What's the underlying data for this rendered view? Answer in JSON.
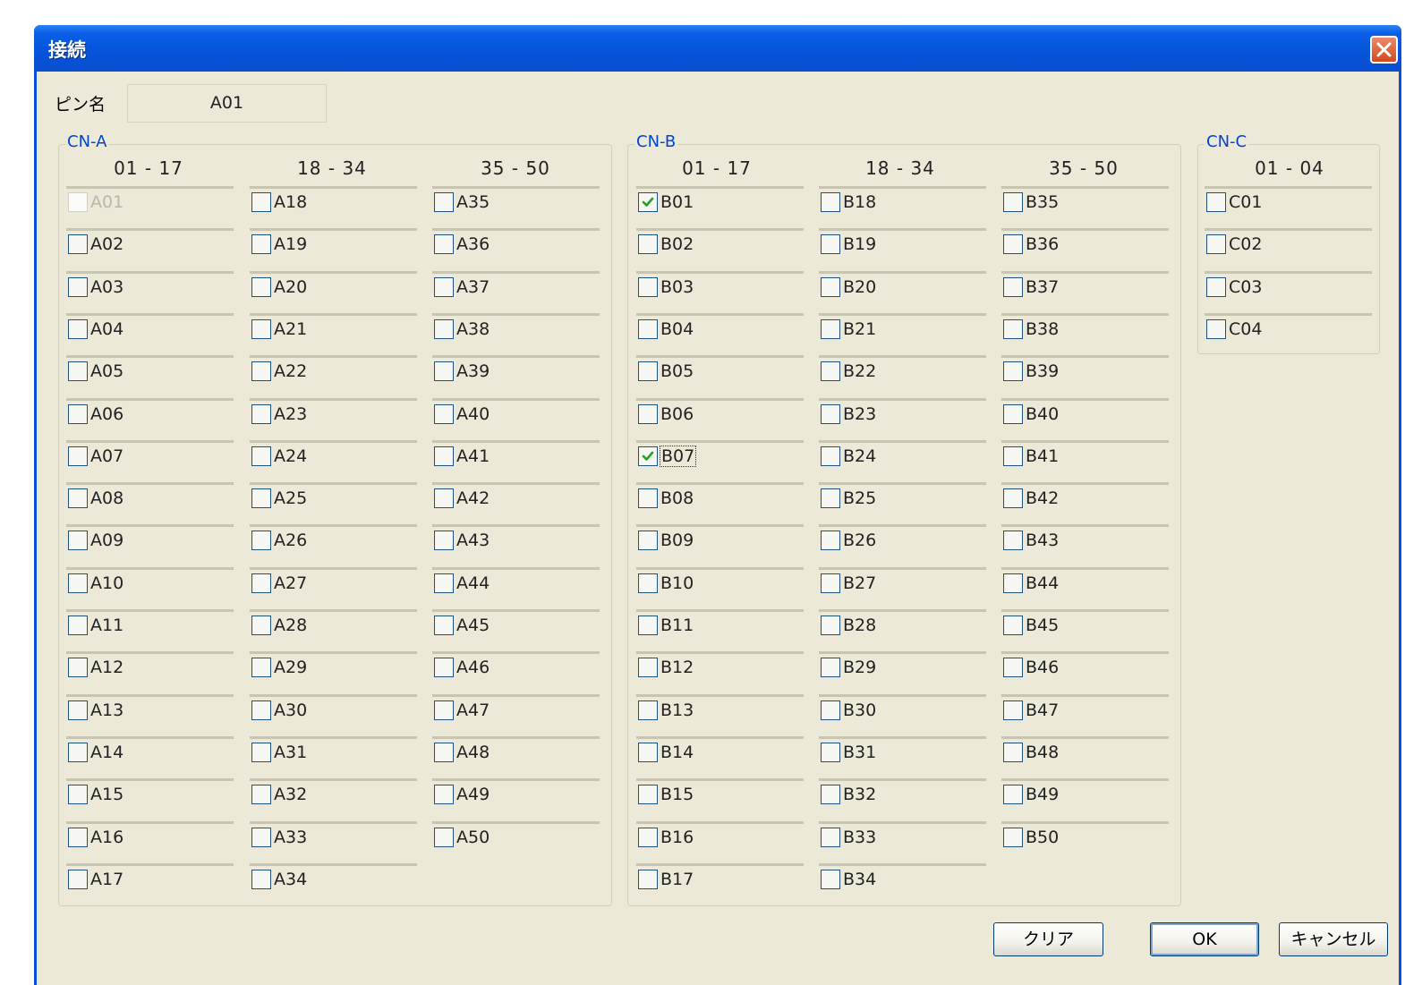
{
  "window": {
    "title": "接続"
  },
  "pin": {
    "label": "ピン名",
    "value": "A01"
  },
  "groups": [
    {
      "title": "CN-A",
      "columns": [
        {
          "header": "01 - 17",
          "items": [
            {
              "label": "A01",
              "checked": false,
              "disabled": true
            },
            {
              "label": "A02",
              "checked": false
            },
            {
              "label": "A03",
              "checked": false
            },
            {
              "label": "A04",
              "checked": false
            },
            {
              "label": "A05",
              "checked": false
            },
            {
              "label": "A06",
              "checked": false
            },
            {
              "label": "A07",
              "checked": false
            },
            {
              "label": "A08",
              "checked": false
            },
            {
              "label": "A09",
              "checked": false
            },
            {
              "label": "A10",
              "checked": false
            },
            {
              "label": "A11",
              "checked": false
            },
            {
              "label": "A12",
              "checked": false
            },
            {
              "label": "A13",
              "checked": false
            },
            {
              "label": "A14",
              "checked": false
            },
            {
              "label": "A15",
              "checked": false
            },
            {
              "label": "A16",
              "checked": false
            },
            {
              "label": "A17",
              "checked": false
            }
          ]
        },
        {
          "header": "18 - 34",
          "items": [
            {
              "label": "A18",
              "checked": false
            },
            {
              "label": "A19",
              "checked": false
            },
            {
              "label": "A20",
              "checked": false
            },
            {
              "label": "A21",
              "checked": false
            },
            {
              "label": "A22",
              "checked": false
            },
            {
              "label": "A23",
              "checked": false
            },
            {
              "label": "A24",
              "checked": false
            },
            {
              "label": "A25",
              "checked": false
            },
            {
              "label": "A26",
              "checked": false
            },
            {
              "label": "A27",
              "checked": false
            },
            {
              "label": "A28",
              "checked": false
            },
            {
              "label": "A29",
              "checked": false
            },
            {
              "label": "A30",
              "checked": false
            },
            {
              "label": "A31",
              "checked": false
            },
            {
              "label": "A32",
              "checked": false
            },
            {
              "label": "A33",
              "checked": false
            },
            {
              "label": "A34",
              "checked": false
            }
          ]
        },
        {
          "header": "35 - 50",
          "items": [
            {
              "label": "A35",
              "checked": false
            },
            {
              "label": "A36",
              "checked": false
            },
            {
              "label": "A37",
              "checked": false
            },
            {
              "label": "A38",
              "checked": false
            },
            {
              "label": "A39",
              "checked": false
            },
            {
              "label": "A40",
              "checked": false
            },
            {
              "label": "A41",
              "checked": false
            },
            {
              "label": "A42",
              "checked": false
            },
            {
              "label": "A43",
              "checked": false
            },
            {
              "label": "A44",
              "checked": false
            },
            {
              "label": "A45",
              "checked": false
            },
            {
              "label": "A46",
              "checked": false
            },
            {
              "label": "A47",
              "checked": false
            },
            {
              "label": "A48",
              "checked": false
            },
            {
              "label": "A49",
              "checked": false
            },
            {
              "label": "A50",
              "checked": false
            }
          ]
        }
      ]
    },
    {
      "title": "CN-B",
      "columns": [
        {
          "header": "01 - 17",
          "items": [
            {
              "label": "B01",
              "checked": true
            },
            {
              "label": "B02",
              "checked": false
            },
            {
              "label": "B03",
              "checked": false
            },
            {
              "label": "B04",
              "checked": false
            },
            {
              "label": "B05",
              "checked": false
            },
            {
              "label": "B06",
              "checked": false
            },
            {
              "label": "B07",
              "checked": true,
              "focused": true
            },
            {
              "label": "B08",
              "checked": false
            },
            {
              "label": "B09",
              "checked": false
            },
            {
              "label": "B10",
              "checked": false
            },
            {
              "label": "B11",
              "checked": false
            },
            {
              "label": "B12",
              "checked": false
            },
            {
              "label": "B13",
              "checked": false
            },
            {
              "label": "B14",
              "checked": false
            },
            {
              "label": "B15",
              "checked": false
            },
            {
              "label": "B16",
              "checked": false
            },
            {
              "label": "B17",
              "checked": false
            }
          ]
        },
        {
          "header": "18 - 34",
          "items": [
            {
              "label": "B18",
              "checked": false
            },
            {
              "label": "B19",
              "checked": false
            },
            {
              "label": "B20",
              "checked": false
            },
            {
              "label": "B21",
              "checked": false
            },
            {
              "label": "B22",
              "checked": false
            },
            {
              "label": "B23",
              "checked": false
            },
            {
              "label": "B24",
              "checked": false
            },
            {
              "label": "B25",
              "checked": false
            },
            {
              "label": "B26",
              "checked": false
            },
            {
              "label": "B27",
              "checked": false
            },
            {
              "label": "B28",
              "checked": false
            },
            {
              "label": "B29",
              "checked": false
            },
            {
              "label": "B30",
              "checked": false
            },
            {
              "label": "B31",
              "checked": false
            },
            {
              "label": "B32",
              "checked": false
            },
            {
              "label": "B33",
              "checked": false
            },
            {
              "label": "B34",
              "checked": false
            }
          ]
        },
        {
          "header": "35 - 50",
          "items": [
            {
              "label": "B35",
              "checked": false
            },
            {
              "label": "B36",
              "checked": false
            },
            {
              "label": "B37",
              "checked": false
            },
            {
              "label": "B38",
              "checked": false
            },
            {
              "label": "B39",
              "checked": false
            },
            {
              "label": "B40",
              "checked": false
            },
            {
              "label": "B41",
              "checked": false
            },
            {
              "label": "B42",
              "checked": false
            },
            {
              "label": "B43",
              "checked": false
            },
            {
              "label": "B44",
              "checked": false
            },
            {
              "label": "B45",
              "checked": false
            },
            {
              "label": "B46",
              "checked": false
            },
            {
              "label": "B47",
              "checked": false
            },
            {
              "label": "B48",
              "checked": false
            },
            {
              "label": "B49",
              "checked": false
            },
            {
              "label": "B50",
              "checked": false
            }
          ]
        }
      ]
    },
    {
      "title": "CN-C",
      "columns": [
        {
          "header": "01 - 04",
          "items": [
            {
              "label": "C01",
              "checked": false
            },
            {
              "label": "C02",
              "checked": false
            },
            {
              "label": "C03",
              "checked": false
            },
            {
              "label": "C04",
              "checked": false
            }
          ]
        }
      ]
    }
  ],
  "buttons": {
    "clear": "クリア",
    "ok": "OK",
    "cancel": "キャンセル"
  },
  "colors": {
    "titlebar": "#0553d9",
    "dialog_bg": "#ece9d8",
    "group_title": "#0046d5",
    "checkmark": "#21a121",
    "close_button": "#d24a20"
  }
}
